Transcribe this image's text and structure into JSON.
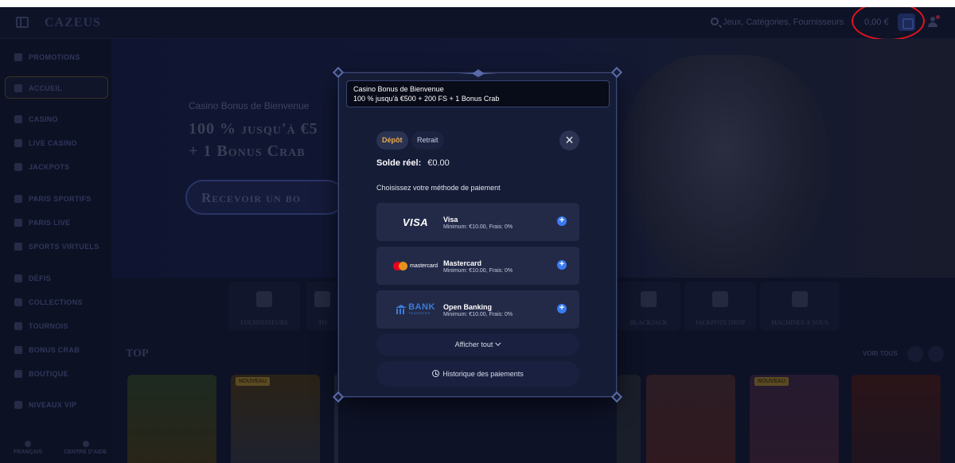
{
  "header": {
    "brand": "CAZEUS",
    "search_placeholder": "Jeux, Catégories, Fournisseurs",
    "balance": "0,00 €"
  },
  "sidebar": {
    "items": [
      {
        "label": "PROMOTIONS",
        "icon": "gift-icon"
      },
      {
        "label": "ACCUEIL",
        "icon": "home-icon"
      },
      {
        "label": "CASINO",
        "icon": "cards-icon"
      },
      {
        "label": "LIVE CASINO",
        "icon": "live-icon"
      },
      {
        "label": "JACKPOTS",
        "icon": "jackpot-icon"
      },
      {
        "label": "PARIS SPORTIFS",
        "icon": "ball-icon"
      },
      {
        "label": "PARIS LIVE",
        "icon": "tv-icon"
      },
      {
        "label": "SPORTS VIRTUELS",
        "icon": "gamepad-icon"
      },
      {
        "label": "DÉFIS",
        "icon": "trophy-icon"
      },
      {
        "label": "COLLECTIONS",
        "icon": "collection-icon"
      },
      {
        "label": "TOURNOIS",
        "icon": "cup-icon"
      },
      {
        "label": "BONUS CRAB",
        "icon": "crab-icon"
      },
      {
        "label": "BOUTIQUE",
        "icon": "shop-icon"
      },
      {
        "label": "NIVEAUX VIP",
        "icon": "diamond-icon"
      }
    ],
    "footer": {
      "language": "FRANÇAIS",
      "help": "CENTRE D'AIDE"
    }
  },
  "hero": {
    "subtitle": "Casino Bonus de Bienvenue",
    "title_line1": "100 % jusqu'à €5",
    "title_line2": "+ 1 Bonus Crab",
    "cta": "Recevoir un bo"
  },
  "categories": [
    "FOURNISSEURS",
    "TO",
    "BLACKJACK",
    "JACKPOTS DROP",
    "MACHINES À SOUS"
  ],
  "top": {
    "title": "TOP",
    "see_all": "VOIR TOUS",
    "new_badge": "NOUVEAU"
  },
  "modal": {
    "bonus_title": "Casino Bonus de Bienvenue",
    "bonus_offer": "100 % jusqu'à €500 + 200 FS + 1 Bonus Crab",
    "tabs": {
      "deposit": "Dépôt",
      "withdraw": "Retrait"
    },
    "balance_label": "Solde réel:",
    "balance_value": "€0.00",
    "choose_method": "Choisissez votre méthode de paiement",
    "methods": [
      {
        "name": "Visa",
        "details": "Minimum: €10.00, Frais: 0%",
        "logo": "VISA"
      },
      {
        "name": "Mastercard",
        "details": "Minimum: €10.00, Frais: 0%",
        "logo": "mastercard"
      },
      {
        "name": "Open Banking",
        "details": "Minimum: €10.00, Frais: 0%",
        "logo": "BANK",
        "logo_sub": "TRANSFER"
      }
    ],
    "show_all": "Afficher tout",
    "history": "Historique des paiements"
  }
}
